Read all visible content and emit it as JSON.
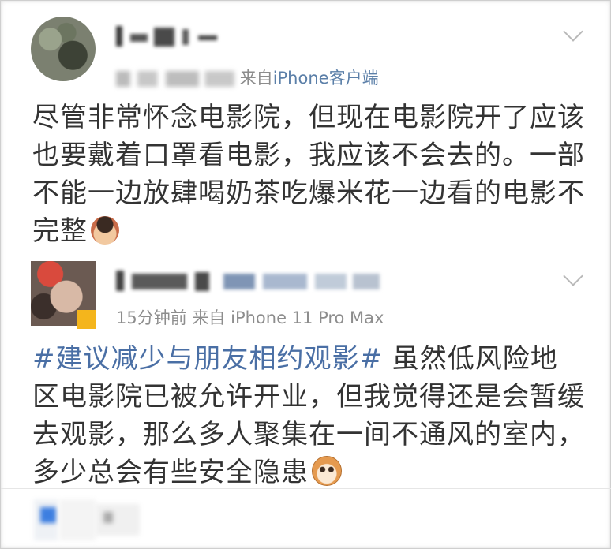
{
  "post1": {
    "username": "",
    "meta_time": "",
    "meta_from": "来自",
    "meta_source": "iPhone客户端",
    "text_parts": [
      "尽管非常怀念电影院，但现在电影院开了应该也要戴着口罩看电影，我应该不会去的。一部不能一边放肆喝奶茶吃爆米花一边看的电影不完整"
    ],
    "emoji": "boy-face-emoji"
  },
  "post2": {
    "username": "",
    "meta_time": "15分钟前",
    "meta_from": "来自",
    "meta_source": "iPhone 11 Pro Max",
    "hashtag": "#建议减少与朋友相约观影#",
    "text": " 虽然低风险地区电影院已被允许开业，但我觉得还是会暂缓去观影，那么多人聚集在一间不通风的室内，多少总会有些安全隐患",
    "emoji": "cat-face-emoji"
  },
  "colors": {
    "text": "#333333",
    "meta": "#8d8d8d",
    "hashtag": "#4a6fa5",
    "source_link": "#5b7fa8"
  }
}
